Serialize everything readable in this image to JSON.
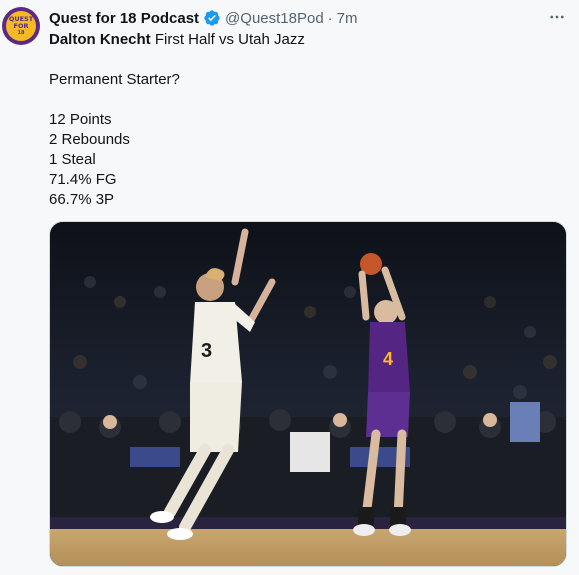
{
  "author": {
    "display_name": "Quest for 18 Podcast",
    "handle": "@Quest18Pod",
    "separator": "·",
    "timestamp": "7m",
    "avatar_text": [
      "QUEST",
      "FOR",
      "18"
    ],
    "verified": true
  },
  "post": {
    "line1_bold": "Dalton Knecht",
    "line1_rest": " First Half vs Utah Jazz",
    "blank1": "",
    "question": "Permanent Starter?",
    "blank2": "",
    "stats": [
      "12 Points",
      "2 Rebounds",
      "1 Steal",
      "71.4% FG",
      "66.7% 3P"
    ]
  },
  "menu": {
    "icon": "more-horizontal-icon",
    "label": "···"
  },
  "media": {
    "type": "photo",
    "jersey_left": "3",
    "jersey_right": "4"
  },
  "colors": {
    "verified_blue": "#1d9bf0",
    "text": "#0f1419",
    "muted": "#536471",
    "lakers_purple": "#552583",
    "lakers_gold": "#fdb927"
  }
}
